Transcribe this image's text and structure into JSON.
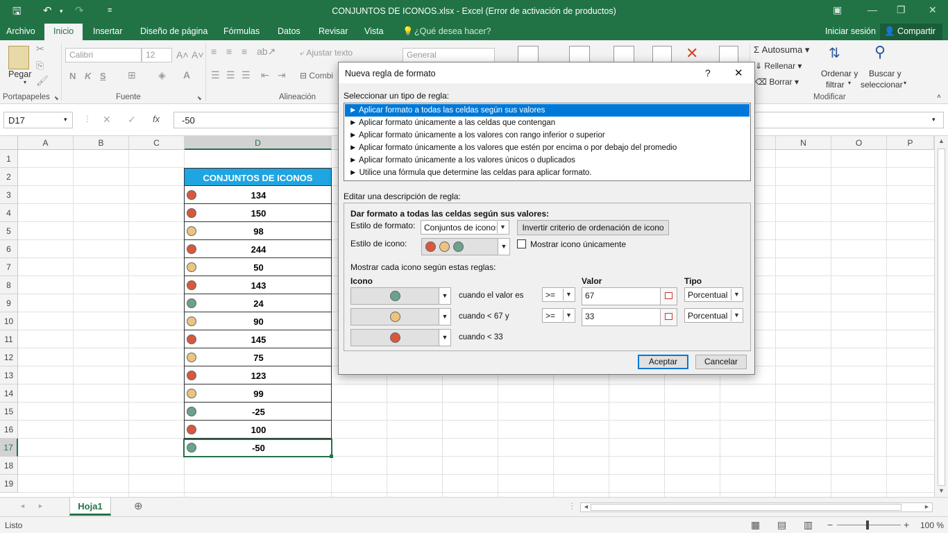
{
  "window": {
    "title": "CONJUNTOS DE ICONOS.xlsx - Excel (Error de activación de productos)"
  },
  "colors": {
    "excel_green": "#217346",
    "icon_red": "#d9583b",
    "icon_yellow": "#edc381",
    "icon_green": "#6aa28e",
    "header_fill": "#1ea5e2",
    "selection_blue": "#0078d7"
  },
  "ribbon_tabs": [
    "Archivo",
    "Inicio",
    "Insertar",
    "Diseño de página",
    "Fórmulas",
    "Datos",
    "Revisar",
    "Vista"
  ],
  "tell_me": "¿Qué desea hacer?",
  "account": {
    "signin": "Iniciar sesión",
    "share": "Compartir"
  },
  "ribbon": {
    "paste": "Pegar",
    "font_name": "Calibri",
    "font_size": "12",
    "bold": "N",
    "italic": "K",
    "underline": "S",
    "wrap_text": "Ajustar texto",
    "merge": "Combi",
    "number_format": "General",
    "autosum": "Autosuma",
    "fill": "Rellenar",
    "clear": "Borrar",
    "sort_filter_1": "Ordenar y",
    "sort_filter_2": "filtrar",
    "find_select_1": "Buscar y",
    "find_select_2": "seleccionar",
    "groups": {
      "clipboard": "Portapapeles",
      "font": "Fuente",
      "alignment": "Alineación",
      "editing": "Modificar"
    }
  },
  "namebox": "D17",
  "formula": "-50",
  "fx": "fx",
  "columns": [
    "A",
    "B",
    "C",
    "D",
    "N",
    "O",
    "P"
  ],
  "rows": [
    "1",
    "2",
    "3",
    "4",
    "5",
    "6",
    "7",
    "8",
    "9",
    "10",
    "11",
    "12",
    "13",
    "14",
    "15",
    "16",
    "17",
    "18",
    "19"
  ],
  "table": {
    "header": "CONJUNTOS DE ICONOS",
    "values": [
      "134",
      "150",
      "98",
      "244",
      "50",
      "143",
      "24",
      "90",
      "145",
      "75",
      "123",
      "99",
      "-25",
      "100",
      "-50"
    ],
    "icons": [
      "red",
      "red",
      "yellow",
      "red",
      "yellow",
      "red",
      "green",
      "yellow",
      "red",
      "yellow",
      "red",
      "yellow",
      "green",
      "red",
      "green"
    ]
  },
  "dialog": {
    "title": "Nueva regla de formato",
    "help": "?",
    "close": "✕",
    "select_type_label": "Seleccionar un tipo de regla:",
    "rule_types": [
      "Aplicar formato a todas las celdas según sus valores",
      "Aplicar formato únicamente a las celdas que contengan",
      "Aplicar formato únicamente a los valores con rango inferior o superior",
      "Aplicar formato únicamente a los valores que estén por encima o por debajo del promedio",
      "Aplicar formato únicamente a los valores únicos o duplicados",
      "Utilice una fórmula que determine las celdas para aplicar formato."
    ],
    "edit_label": "Editar una descripción de regla:",
    "format_all_label": "Dar formato a todas las celdas según sus valores:",
    "format_style_label": "Estilo de formato:",
    "format_style_value": "Conjuntos de iconos",
    "reverse_button": "Invertir criterio de ordenación de icono",
    "icon_style_label": "Estilo de icono:",
    "show_icon_only": "Mostrar icono únicamente",
    "rules_label": "Mostrar cada icono según estas reglas:",
    "col_icon": "Icono",
    "col_value": "Valor",
    "col_type": "Tipo",
    "rules": [
      {
        "condition": "cuando el valor es",
        "operator": ">=",
        "value": "67",
        "type": "Porcentual",
        "icon": "green"
      },
      {
        "condition": "cuando < 67 y",
        "operator": ">=",
        "value": "33",
        "type": "Porcentual",
        "icon": "yellow"
      },
      {
        "condition": "cuando < 33",
        "icon": "red"
      }
    ],
    "ok": "Aceptar",
    "cancel": "Cancelar"
  },
  "sheet_tab": "Hoja1",
  "status": {
    "ready": "Listo",
    "zoom": "100 %"
  }
}
